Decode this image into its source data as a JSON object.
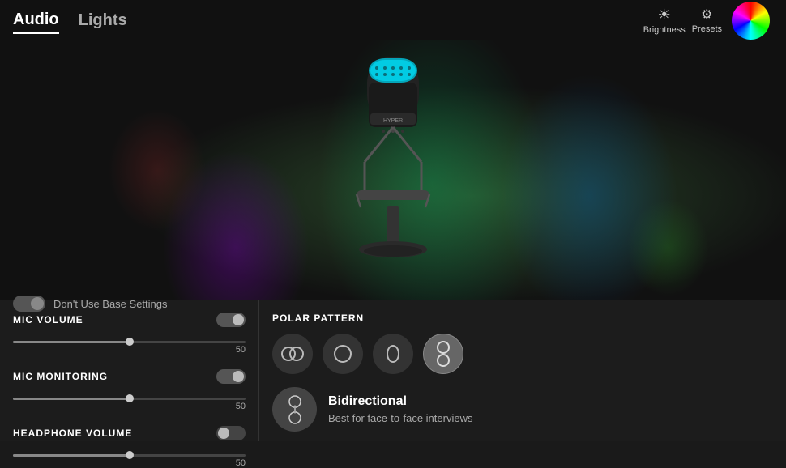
{
  "header": {
    "tabs": [
      {
        "id": "audio",
        "label": "Audio",
        "active": true
      },
      {
        "id": "lights",
        "label": "Lights",
        "active": false
      }
    ],
    "brightness": {
      "label": "Brightness",
      "icon": "sun-icon"
    },
    "presets": {
      "label": "Presets",
      "icon": "sliders-icon"
    }
  },
  "toggle": {
    "label": "Don't Use Base Settings",
    "state": "on"
  },
  "mic_volume": {
    "title": "MIC VOLUME",
    "value": 50,
    "percent": 50,
    "enabled": true
  },
  "mic_monitoring": {
    "title": "MIC MONITORING",
    "value": 50,
    "percent": 50,
    "enabled": true
  },
  "headphone_volume": {
    "title": "HEADPHONE VOLUME",
    "value": 50,
    "percent": 50,
    "enabled": false
  },
  "polar_pattern": {
    "title": "POLAR PATTERN",
    "patterns": [
      {
        "id": "stereo",
        "label": "Stereo",
        "active": false
      },
      {
        "id": "cardioid",
        "label": "Cardioid",
        "active": false
      },
      {
        "id": "omnidirectional",
        "label": "Omnidirectional",
        "active": false
      },
      {
        "id": "bidirectional",
        "label": "Bidirectional",
        "active": true
      }
    ],
    "selected": {
      "name": "Bidirectional",
      "description": "Best for face-to-face interviews"
    }
  }
}
